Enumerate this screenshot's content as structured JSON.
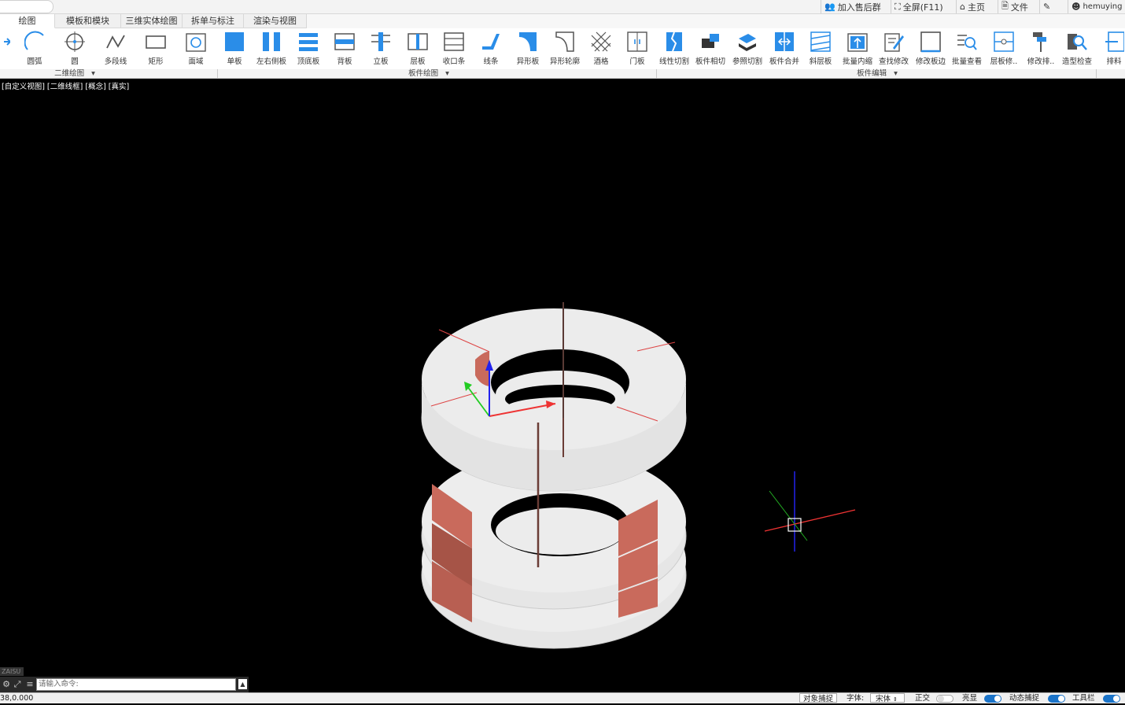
{
  "topbar": {
    "items": [
      {
        "icon": "user-group-icon",
        "label": "加入售后群"
      },
      {
        "icon": "fullscreen-icon",
        "label": "全屏(F11)"
      },
      {
        "icon": "home-icon",
        "label": "主页"
      },
      {
        "icon": "file-icon",
        "label": "文件"
      },
      {
        "icon": "edit-icon",
        "label": ""
      },
      {
        "icon": "user-icon",
        "label": "hemuying"
      }
    ]
  },
  "tabs": [
    "绘图",
    "模板和模块",
    "三维实体绘图",
    "拆单与标注",
    "渲染与视图"
  ],
  "ribbon": {
    "tools": [
      "",
      "圆弧",
      "圆",
      "多段线",
      "矩形",
      "面域",
      "单板",
      "左右侧板",
      "顶底板",
      "背板",
      "立板",
      "层板",
      "收口条",
      "线条",
      "异形板",
      "异形轮廓",
      "酒格",
      "门板",
      "线性切割",
      "板件相切",
      "参照切割",
      "板件合并",
      "斜层板",
      "批量内缩",
      "查找修改",
      "修改板边",
      "批量查看",
      "层板修..",
      "修改排..",
      "造型检查",
      "排料"
    ],
    "groups": [
      "二维绘图",
      "板件绘图",
      "板件编辑"
    ]
  },
  "view_label": "[自定义视图] [二维线框] [概念] [真实]",
  "command": {
    "placeholder": "请输入命令:",
    "side_tag": "ZAISU"
  },
  "status": {
    "coords": "38,0.000",
    "object_snap": "对象捕捉",
    "font_label": "字体:",
    "font_value": "宋体",
    "ortho": "正交",
    "highlight": "亮显",
    "dynamic_snap": "动态捕捉",
    "toolbar": "工具栏"
  },
  "colors": {
    "accent": "#1a73c8",
    "tool_blue": "#2a8de8",
    "panel": "#e8e8e8",
    "cut_face": "#c96a5c"
  }
}
